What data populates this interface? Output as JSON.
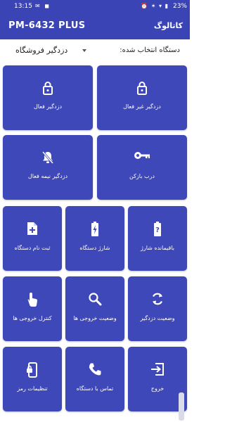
{
  "status": {
    "time": "13:15",
    "battery": "23%"
  },
  "appbar": {
    "title": "PM-6432 PLUS",
    "catalog": "کاتالوگ"
  },
  "selector": {
    "label": "دستگاه انتخاب شده:",
    "value": "دزدگیر فروشگاه"
  },
  "tiles": [
    {
      "label": "دزدگیر غیر فعال",
      "icon": "lock-icon"
    },
    {
      "label": "دزدگیر فعال",
      "icon": "lock-icon"
    },
    {
      "label": "درب بازکن",
      "icon": "key-icon"
    },
    {
      "label": "دزدگیر نیمه فعال",
      "icon": "bell-off-icon"
    },
    {
      "label": "باقیمانده شارژ",
      "icon": "battery-unknown-icon"
    },
    {
      "label": "شارژ دستگاه",
      "icon": "battery-charging-icon"
    },
    {
      "label": "ثبت نام دستگاه",
      "icon": "add-file-icon"
    },
    {
      "label": "وضعیت دزدگیر",
      "icon": "refresh-icon"
    },
    {
      "label": "وضعیت خروجی ها",
      "icon": "search-icon"
    },
    {
      "label": "کنترل خروجی ها",
      "icon": "touch-icon"
    },
    {
      "label": "خروج",
      "icon": "exit-icon"
    },
    {
      "label": "تماس با دستگاه",
      "icon": "phone-icon"
    },
    {
      "label": "تنظیمات رمز",
      "icon": "phone-lock-icon"
    }
  ]
}
